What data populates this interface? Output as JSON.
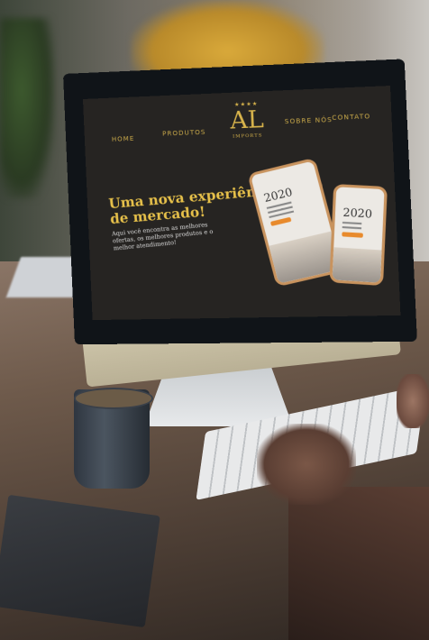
{
  "website": {
    "nav": {
      "home": "HOME",
      "produtos": "PRODUTOS",
      "sobre": "SOBRE NÓS",
      "contato": "CONTATO"
    },
    "logo": {
      "mark": "AL",
      "sub": "IMPORTS"
    },
    "hero": {
      "headline_line1": "Uma nova experiência",
      "headline_line2": "de mercado!",
      "lead": "Aqui você encontra as melhores ofertas, os melhores produtos e o melhor atendimento!"
    },
    "phone_year": "2020",
    "accent_color": "#e6c04a",
    "background_color": "#262422"
  }
}
